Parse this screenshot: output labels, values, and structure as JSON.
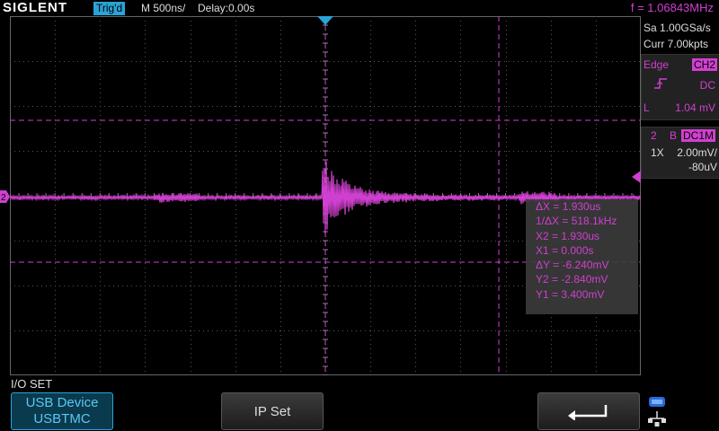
{
  "topbar": {
    "logo": "SIGLENT",
    "trigger_status": "Trig'd",
    "timebase": "M 500ns/",
    "delay": "Delay:0.00s",
    "frequency": "f = 1.06843MHz"
  },
  "acquisition": {
    "sample_rate": "Sa 1.00GSa/s",
    "memory": "Curr 7.00kpts"
  },
  "trigger_panel": {
    "type": "Edge",
    "source": "CH2",
    "coupling": "DC",
    "level_prefix": "L",
    "level": "1.04 mV"
  },
  "channel_panel": {
    "number": "2",
    "bw": "B",
    "coupling": "DC1M",
    "probe": "1X",
    "scale": "2.00mV/",
    "offset": "-80uV"
  },
  "cursor_measurements": {
    "delta_x": "ΔX = 1.930us",
    "inv_delta_x": "1/ΔX = 518.1kHz",
    "x2": "X2 = 1.930us",
    "x1": "X1 = 0.000s",
    "delta_y": "ΔY = -6.240mV",
    "y2": "Y2 = -2.840mV",
    "y1": "Y1 = 3.400mV"
  },
  "menu": {
    "title": "I/O SET",
    "usb_line1": "USB Device",
    "usb_line2": "USBTMC",
    "ip_set": "IP Set"
  },
  "colors": {
    "channel2": "#d040d0",
    "trigger_blue": "#2aa4d8"
  },
  "icons": {
    "back": "return-arrow-icon",
    "network": "network-icon"
  }
}
